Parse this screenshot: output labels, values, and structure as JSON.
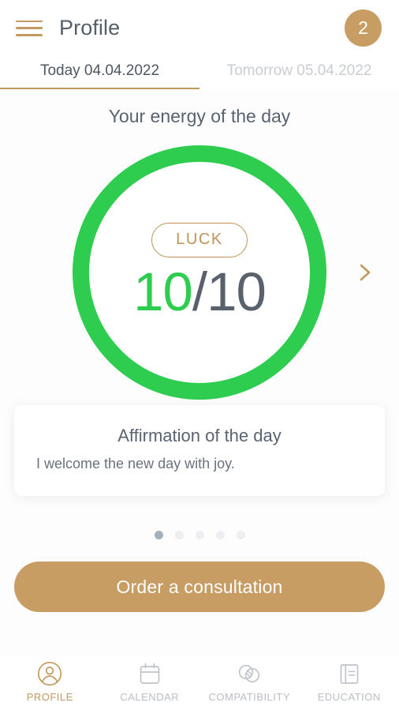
{
  "header": {
    "menu_icon": "hamburger-menu-icon",
    "title": "Profile",
    "badge_count": "2",
    "accent_color": "#c79d64"
  },
  "date_tabs": [
    {
      "label": "Today 04.04.2022",
      "active": true
    },
    {
      "label": "Tomorrow 05.04.2022",
      "active": false
    }
  ],
  "main": {
    "section_title": "Your energy of the day",
    "energy": {
      "label": "LUCK",
      "score": "10",
      "separator": "/",
      "max": "10",
      "ring_color": "#2ecc4f",
      "score_color": "#2ecc4f",
      "max_color": "#59616d",
      "label_color": "#bf9357"
    },
    "next_arrow_icon": "chevron-right-icon",
    "affirmation": {
      "title": "Affirmation of the day",
      "text": "I welcome the new day with joy."
    },
    "carousel": {
      "total": 5,
      "active_index": 0
    },
    "cta_label": "Order a consultation"
  },
  "bottom_nav": [
    {
      "label": "PROFILE",
      "icon": "profile-icon",
      "active": true
    },
    {
      "label": "CALENDAR",
      "icon": "calendar-icon",
      "active": false
    },
    {
      "label": "COMPATIBILITY",
      "icon": "compatibility-icon",
      "active": false
    },
    {
      "label": "EDUCATION",
      "icon": "education-book-icon",
      "active": false
    }
  ]
}
